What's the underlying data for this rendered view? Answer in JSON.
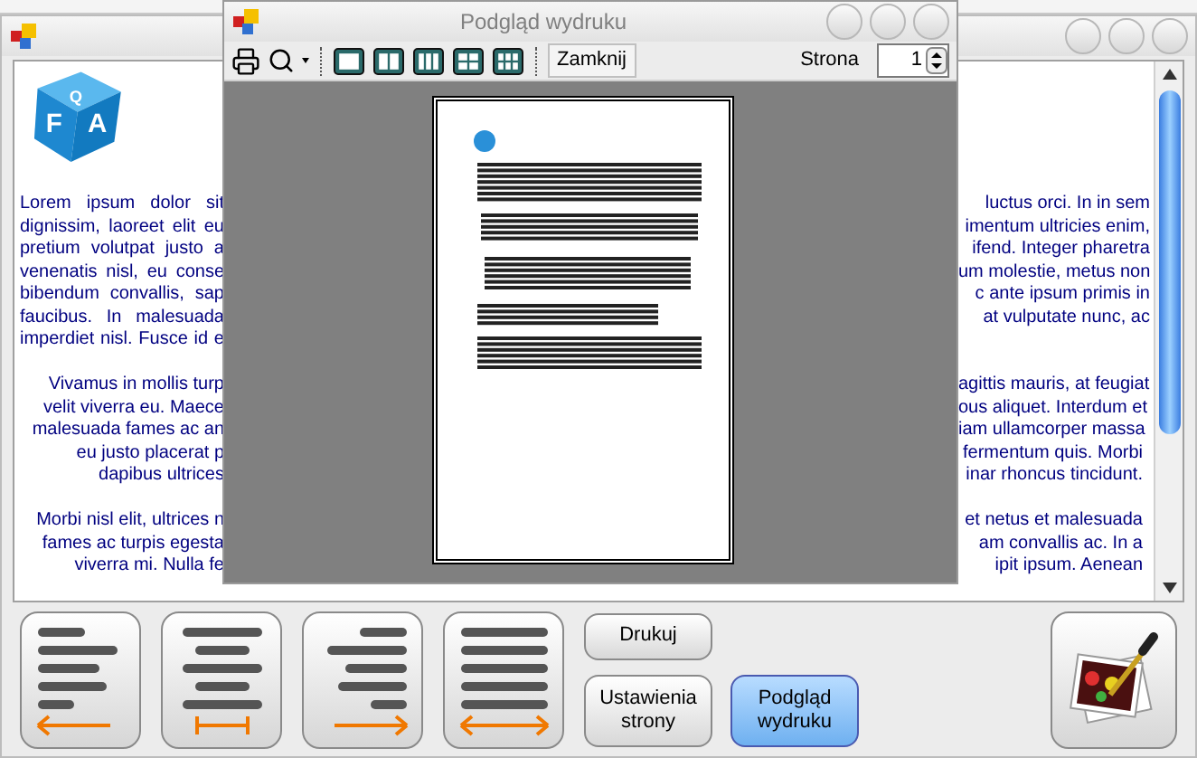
{
  "main_window": {
    "logo": {
      "letters": [
        "F",
        "A",
        "Q"
      ]
    },
    "paragraphs": [
      {
        "kind": "justify",
        "lines": [
          {
            "left": "Lorem ipsum dolor sit",
            "right": "luctus orci. In in sem"
          },
          {
            "left": "dignissim, laoreet elit eu",
            "right": "imentum ultricies enim,"
          },
          {
            "left": "pretium volutpat justo a",
            "right": "ifend. Integer pharetra"
          },
          {
            "left": "venenatis nisl, eu conse",
            "right": "um molestie, metus non"
          },
          {
            "left": "bibendum convallis, sap",
            "right": "c ante ipsum primis in"
          },
          {
            "left": "faucibus. In malesuada",
            "right": "at vulputate nunc, ac"
          },
          {
            "left": "imperdiet nisl. Fusce id e"
          }
        ]
      },
      {
        "kind": "center",
        "lines": [
          {
            "left": "Vivamus in mollis turp",
            "right": "agittis mauris, at feugiat"
          },
          {
            "left": "velit viverra eu. Maece",
            "right": "ous aliquet. Interdum et"
          },
          {
            "left": "malesuada fames ac an",
            "right": "iam ullamcorper massa"
          },
          {
            "left": "eu justo placerat p",
            "right": "fermentum quis. Morbi"
          },
          {
            "left": "dapibus ultrices",
            "right": "inar rhoncus tincidunt."
          }
        ]
      },
      {
        "kind": "center",
        "lines": [
          {
            "left": "Morbi nisl elit, ultrices n",
            "right": "et netus et malesuada"
          },
          {
            "left": "fames ac turpis egesta",
            "right": "am convallis ac. In a"
          },
          {
            "left": "viverra mi. Nulla fe",
            "right": "ipit ipsum. Aenean"
          }
        ]
      }
    ]
  },
  "toolbar": {
    "align_buttons": [
      {
        "kind": "left"
      },
      {
        "kind": "center"
      },
      {
        "kind": "right"
      },
      {
        "kind": "justify"
      }
    ],
    "buttons": [
      {
        "label": "Drukuj",
        "selected": false
      },
      {
        "label": "Ustawienia strony",
        "selected": false
      },
      {
        "label": "Podgląd wydruku",
        "selected": true
      }
    ]
  },
  "preview_dialog": {
    "title": "Podgląd wydruku",
    "close_button": "Zamknij",
    "page_label": "Strona",
    "page_value": "1"
  }
}
